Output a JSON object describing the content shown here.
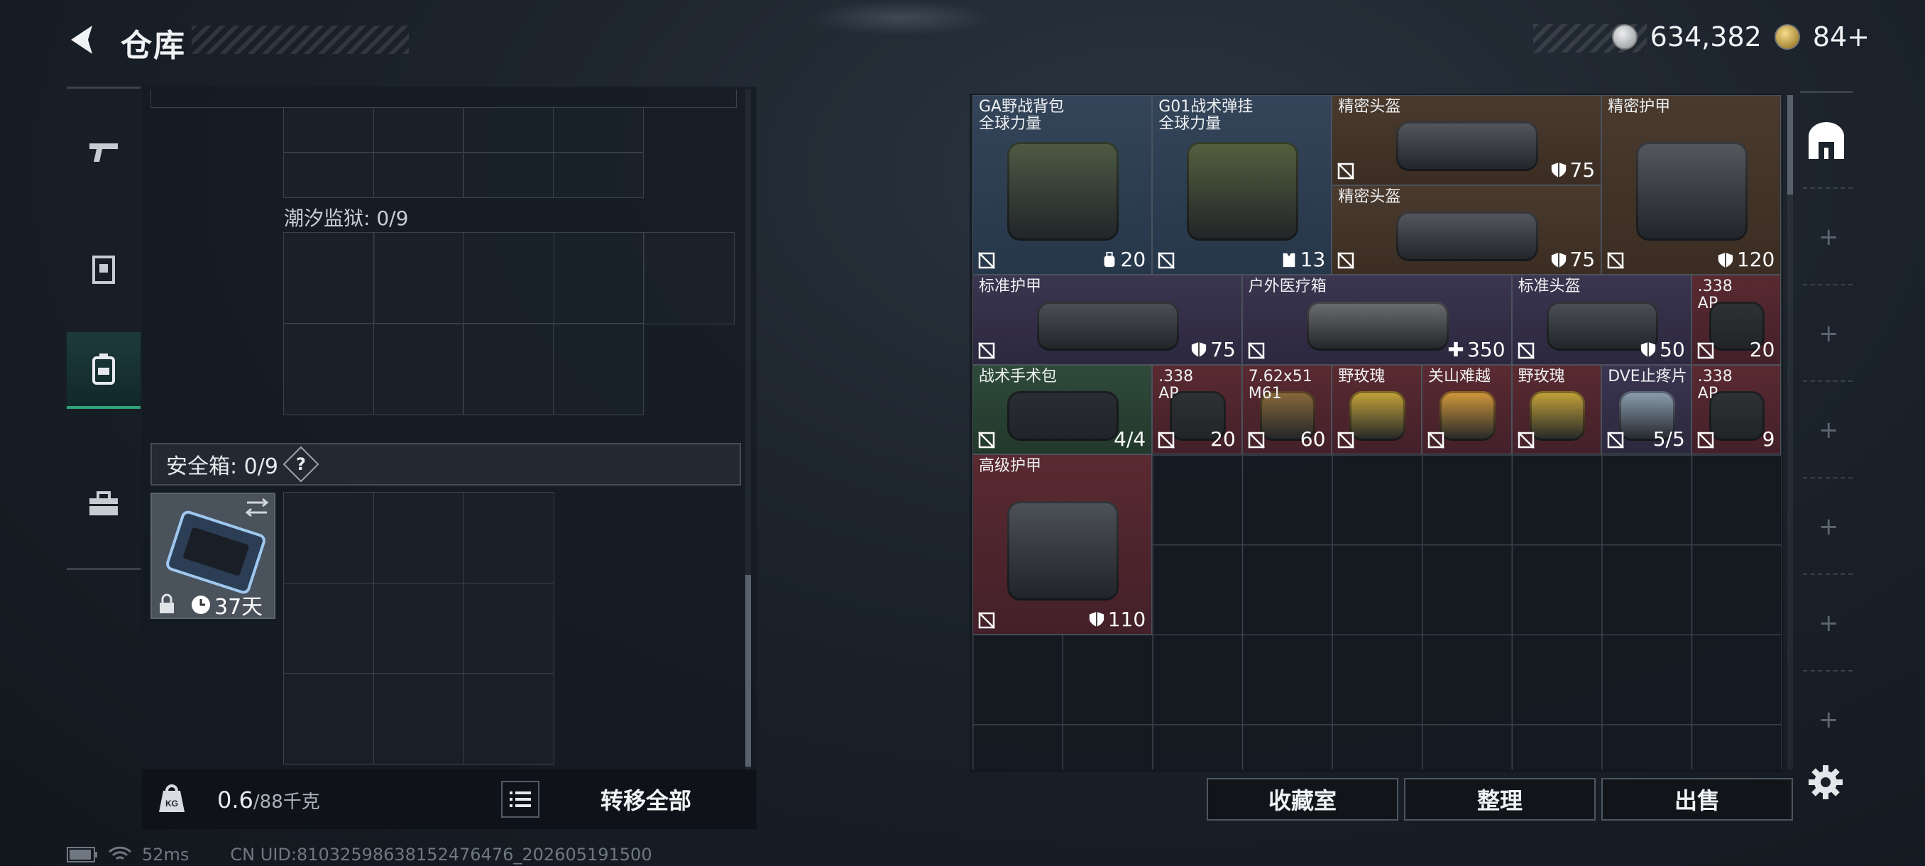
{
  "header": {
    "title": "仓库",
    "currency_silver": "634,382",
    "currency_gold": "84+"
  },
  "nav": {
    "items": [
      "weapon",
      "armor",
      "backpack",
      "toolbox"
    ],
    "active": "backpack"
  },
  "left": {
    "prison_label": "潮汐监狱: 0/9",
    "safe_label": "安全箱: 0/9",
    "safe_help": "?",
    "safe_box_days": "37天",
    "weight_current": "0.6",
    "weight_max": "/88千克",
    "transfer_all": "转移全部"
  },
  "items": [
    {
      "name": "GA野战背包\n全球力量",
      "count": "20",
      "icon": "backpack-icon"
    },
    {
      "name": "G01战术弹挂\n全球力量",
      "count": "13",
      "icon": "vest-icon"
    },
    {
      "name": "精密头盔",
      "count": "75",
      "icon": "shield-icon"
    },
    {
      "name": "精密护甲",
      "count": "120",
      "icon": "shield-icon"
    },
    {
      "name": "精密头盔",
      "count": "75",
      "icon": "shield-icon"
    },
    {
      "name": "标准护甲",
      "count": "75",
      "icon": "shield-icon"
    },
    {
      "name": "户外医疗箱",
      "count": "350",
      "icon": "plus-icon"
    },
    {
      "name": "标准头盔",
      "count": "50",
      "icon": "shield-icon"
    },
    {
      "name": ".338\nAP",
      "count": "20",
      "icon": ""
    },
    {
      "name": "战术手术包",
      "count": "4/4",
      "icon": ""
    },
    {
      "name": ".338\nAP",
      "count": "20",
      "icon": ""
    },
    {
      "name": "7.62x51\nM61",
      "count": "60",
      "icon": ""
    },
    {
      "name": "野玫瑰",
      "count": "",
      "icon": ""
    },
    {
      "name": "关山难越",
      "count": "",
      "icon": ""
    },
    {
      "name": "野玫瑰",
      "count": "",
      "icon": ""
    },
    {
      "name": "DVE止疼片",
      "count": "5/5",
      "icon": ""
    },
    {
      "name": ".338\nAP",
      "count": "9",
      "icon": ""
    },
    {
      "name": "高级护甲",
      "count": "110",
      "icon": "shield-icon"
    }
  ],
  "bottom": {
    "collection": "收藏室",
    "organize": "整理",
    "sell": "出售"
  },
  "status": {
    "ping": "52ms",
    "uid": "CN UID:8103259863815247647​6_202605191500"
  }
}
